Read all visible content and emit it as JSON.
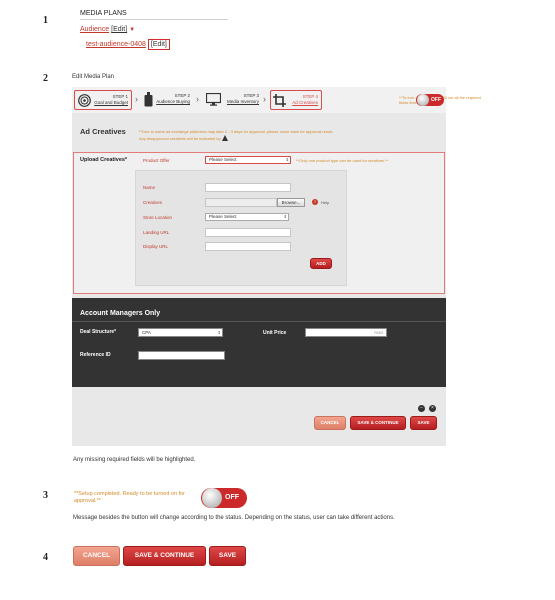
{
  "step_numbers": [
    "1",
    "2",
    "3",
    "4"
  ],
  "section1": {
    "title": "MEDIA PLANS",
    "audience_label": "Audience",
    "audience_edit": "[Edit]",
    "audience_caret": "▼",
    "sub_audience_label": "test-audience-0408",
    "sub_audience_edit": "[Edit]"
  },
  "section2": {
    "panel_title": "Edit Media Plan",
    "steps": [
      {
        "step": "STEP 1",
        "name": "Goal and Budget",
        "icon": "target-icon"
      },
      {
        "step": "STEP 2",
        "name": "Audience Buying",
        "icon": "bottle-icon"
      },
      {
        "step": "STEP 3",
        "name": "Media Inventory",
        "icon": "monitor-icon"
      },
      {
        "step": "STEP 4",
        "name": "Ad Creatives",
        "icon": "crop-icon"
      }
    ],
    "chevron": "›",
    "setup_message": "**To turn on media plan, fill out all the required fields first.**",
    "toggle_label": "OFF",
    "ad_creatives": {
      "title": "Ad Creatives",
      "note_line1": "**Due to some ad exchange platforms may take 2 - 3 days for approval, please come back for approval result.",
      "note_line2": "Any disapproved creatives will be indicated by",
      "upload_label": "Upload Creatives*",
      "product_offer_label": "Product Offer",
      "product_offer_value": "Please Select",
      "product_offer_note": "**Only one product type can be used for creatives.**",
      "fields": {
        "name_label": "Name",
        "creatives_label": "Creatives",
        "browse_label": "Browse...",
        "help_label": "Help",
        "store_location_label": "Store Location",
        "store_location_value": "Please Select",
        "landing_url_label": "Landing URL",
        "display_url_label": "Display URL"
      },
      "add_button": "ADD"
    },
    "account_managers": {
      "title": "Account Managers Only",
      "deal_structure_label": "Deal Structure*",
      "deal_structure_value": "CPA",
      "unit_price_label": "Unit Price",
      "unit_price_unit": "RMB",
      "reference_id_label": "Reference ID"
    },
    "footer_icons": [
      "minus-circle-icon",
      "close-circle-icon"
    ],
    "buttons": {
      "cancel": "CANCEL",
      "save_continue": "SAVE & CONTINUE",
      "save": "SAVE"
    },
    "caption": "Any missing required fields will be highlighted."
  },
  "section3": {
    "message": "**Setup completed. Ready to be turned on for approval.**",
    "toggle_label": "OFF",
    "caption": "Message besides the button will change according to the status. Depending on the status, user can take different actions."
  },
  "section4": {
    "cancel": "CANCEL",
    "save_continue": "SAVE & CONTINUE",
    "save": "SAVE"
  },
  "colors": {
    "accent_red": "#c0392b",
    "note_orange": "#d68a2b",
    "dark_panel": "#333333",
    "panel_grey": "#e8e8e8"
  }
}
